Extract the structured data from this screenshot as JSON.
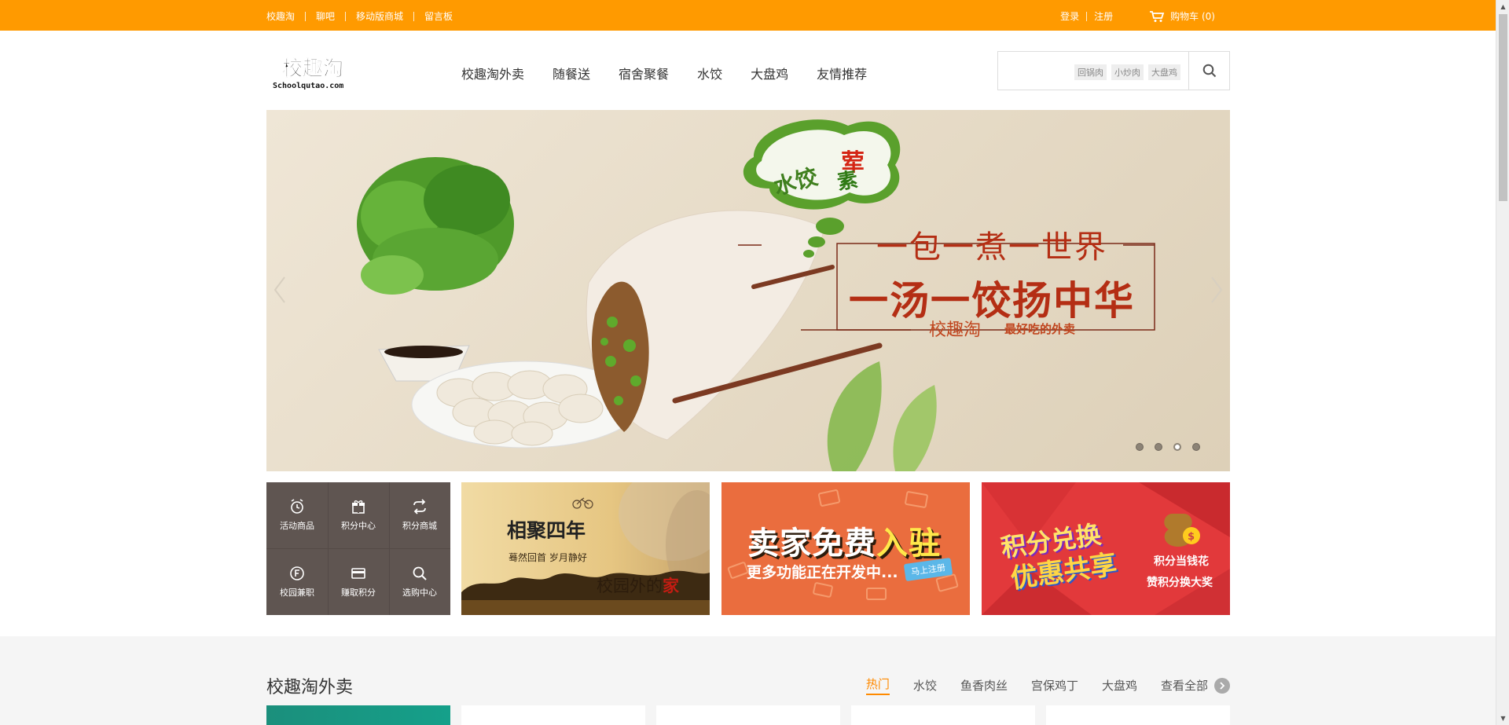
{
  "topbar": {
    "links": [
      "校趣淘",
      "聊吧",
      "移动版商城",
      "留言板"
    ],
    "login": "登录",
    "register": "注册",
    "cart": "购物车 (0)"
  },
  "header": {
    "logo_text": "校趣淘",
    "logo_sub": "Schoolqutao.com",
    "nav": [
      "校趣淘外卖",
      "随餐送",
      "宿舍聚餐",
      "水饺",
      "大盘鸡",
      "友情推荐"
    ],
    "search_tags": [
      "回锅肉",
      "小炒肉",
      "大盘鸡"
    ]
  },
  "banner": {
    "bubble_main": "水饺",
    "bubble_red": "荤",
    "bubble_green": "素",
    "line1": "一包一煮一世界",
    "line2": "一汤一饺扬中华",
    "brand": "校趣淘",
    "slogan": "最好吃的外卖",
    "slides": 4,
    "active_slide": 3
  },
  "quick_menu": [
    {
      "label": "活动商品",
      "icon": "alarm-clock-icon"
    },
    {
      "label": "积分中心",
      "icon": "gift-icon"
    },
    {
      "label": "积分商城",
      "icon": "exchange-icon"
    },
    {
      "label": "校园兼职",
      "icon": "badge-f-icon"
    },
    {
      "label": "赚取积分",
      "icon": "card-icon"
    },
    {
      "label": "选购中心",
      "icon": "search-icon"
    }
  ],
  "promos": {
    "p1": {
      "title": "相聚四年",
      "subtitle": "蓦然回首  岁月静好",
      "caption": "校园外的",
      "caption_em": "家"
    },
    "p2": {
      "title_white": "卖家免费",
      "title_yellow": "入驻",
      "subtitle": "更多功能正在开发中...",
      "badge": "马上注册"
    },
    "p3": {
      "title1": "积分兑换",
      "title2": "优惠共享",
      "line1": "积分当钱花",
      "line2": "赞积分换大奖"
    }
  },
  "section": {
    "title": "校趣淘外卖",
    "tabs": [
      "热门",
      "水饺",
      "鱼香肉丝",
      "宫保鸡丁",
      "大盘鸡",
      "查看全部"
    ],
    "active_tab": "热门"
  },
  "colors": {
    "brand_orange": "#ff9a00",
    "accent": "#ff8a00",
    "quick_bg": "#5f5551"
  }
}
